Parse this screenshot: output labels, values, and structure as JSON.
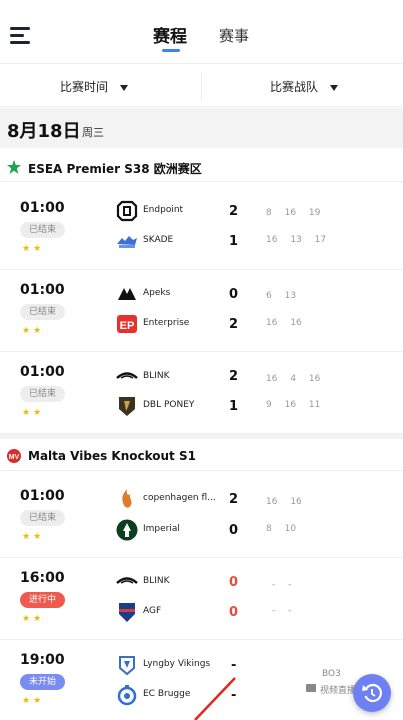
{
  "header": {
    "tabs": [
      {
        "label": "赛程",
        "active": true
      },
      {
        "label": "赛事",
        "active": false
      }
    ]
  },
  "filters": {
    "time_label": "比赛时间",
    "team_label": "比赛战队"
  },
  "date": {
    "main": "8月18日",
    "weekday": "周三"
  },
  "leagues": [
    {
      "name": "ESEA Premier S38 欧洲赛区",
      "matches": [
        {
          "time": "01:00",
          "status": "已结束",
          "stars": "★★",
          "team1": {
            "name": "Endpoint",
            "score": "2",
            "rounds": "8 16 19"
          },
          "team2": {
            "name": "SKADE",
            "score": "1",
            "rounds": "16 13 17"
          }
        },
        {
          "time": "01:00",
          "status": "已结束",
          "stars": "★★",
          "team1": {
            "name": "Apeks",
            "score": "0",
            "rounds": "6 13"
          },
          "team2": {
            "name": "Enterprise",
            "score": "2",
            "rounds": "16 16"
          }
        },
        {
          "time": "01:00",
          "status": "已结束",
          "stars": "★★",
          "team1": {
            "name": "BLINK",
            "score": "2",
            "rounds": "16 4 16"
          },
          "team2": {
            "name": "DBL PONEY",
            "score": "1",
            "rounds": "9 16 11"
          }
        }
      ]
    },
    {
      "name": "Malta Vibes Knockout S1",
      "matches": [
        {
          "time": "01:00",
          "status": "已结束",
          "stars": "★★",
          "team1": {
            "name": "copenhagen fl...",
            "score": "2",
            "rounds": "16 16"
          },
          "team2": {
            "name": "Imperial",
            "score": "0",
            "rounds": "8 10"
          }
        },
        {
          "time": "16:00",
          "status": "进行中",
          "stars": "★★",
          "team1": {
            "name": "BLINK",
            "score": "0",
            "rounds": "- -"
          },
          "team2": {
            "name": "AGF",
            "score": "0",
            "rounds": "- -"
          }
        },
        {
          "time": "19:00",
          "status": "未开始",
          "stars": "★★",
          "team1": {
            "name": "Lyngby Vikings",
            "score": "-",
            "rounds": ""
          },
          "team2": {
            "name": "EC Brugge",
            "score": "-",
            "rounds": ""
          },
          "format": "BO3",
          "video": "视频直播"
        }
      ]
    }
  ],
  "colors": {
    "accent": "#3b82f6",
    "live": "#ef5a4f",
    "pending": "#7b8cf0",
    "star": "#f2b611",
    "fab": "#6e80f2"
  },
  "icons": {
    "menu": "menu-icon",
    "refresh": "refresh-icon",
    "league1": "star-icon",
    "league2": "league-logo-icon"
  }
}
